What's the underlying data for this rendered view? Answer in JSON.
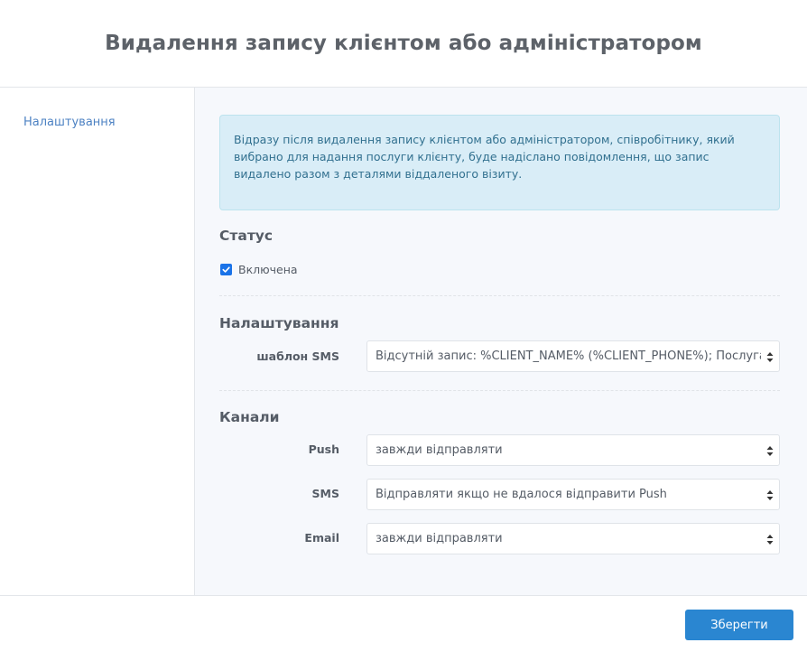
{
  "header": {
    "title": "Видалення запису клієнтом або адміністратором"
  },
  "sidebar": {
    "items": [
      {
        "label": "Налаштування"
      }
    ]
  },
  "info": {
    "text": "Відразу після видалення запису клієнтом або адміністратором, співробітнику, який вибрано для надання послуги клієнту, буде надіслано повідомлення, що запис видалено разом з деталями віддаленого візиту."
  },
  "status": {
    "title": "Статус",
    "checkbox_label": "Включена",
    "checked": true
  },
  "settings": {
    "title": "Налаштування",
    "sms_template_label": "шаблон SMS",
    "sms_template_value": "Відсутній запис: %CLIENT_NAME% (%CLIENT_PHONE%); Послуга: %"
  },
  "channels": {
    "title": "Канали",
    "push_label": "Push",
    "push_value": "завжди відправляти",
    "sms_label": "SMS",
    "sms_value": "Відправляти якщо не вдалося відправити Push",
    "email_label": "Email",
    "email_value": "завжди відправляти"
  },
  "footer": {
    "save_label": "Зберегти"
  },
  "colors": {
    "accent": "#2a86d1",
    "info_bg": "#d9edf7",
    "info_text": "#31708f",
    "link": "#4d82c3",
    "checkbox": "#1a73e8"
  }
}
